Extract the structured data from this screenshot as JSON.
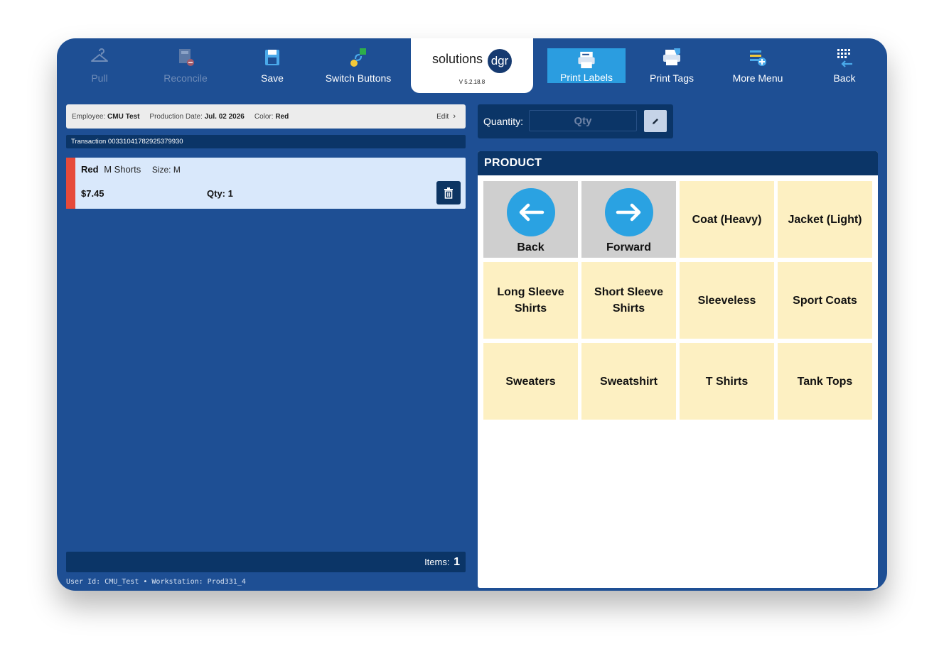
{
  "toolbar": {
    "pull": {
      "label": "Pull",
      "icon": "hanger-icon"
    },
    "reconcile": {
      "label": "Reconcile",
      "icon": "reconcile-icon"
    },
    "save": {
      "label": "Save",
      "icon": "save-icon"
    },
    "switch": {
      "label": "Switch Buttons",
      "icon": "switch-icon"
    },
    "print_labels": {
      "label": "Print Labels",
      "icon": "print-labels-icon"
    },
    "print_tags": {
      "label": "Print Tags",
      "icon": "print-tags-icon"
    },
    "more_menu": {
      "label": "More Menu",
      "icon": "more-menu-icon"
    },
    "back": {
      "label": "Back",
      "icon": "keypad-back-icon"
    }
  },
  "logo": {
    "text": "solutions",
    "mark": "dgr",
    "version": "V 5.2.18.8"
  },
  "info": {
    "employee_label": "Employee:",
    "employee": "CMU Test",
    "date_label": "Production Date:",
    "date": "Jul. 02 2026",
    "color_label": "Color:",
    "color": "Red",
    "edit": "Edit"
  },
  "transaction": "Transaction 00331041782925379930",
  "item": {
    "color": "Red",
    "name": "M Shorts",
    "size": "Size: M",
    "price": "$7.45",
    "qty": "Qty: 1"
  },
  "items_bar": {
    "label": "Items:",
    "count": "1"
  },
  "footer": "User Id: CMU_Test • Workstation: Prod331_4",
  "quantity": {
    "label": "Quantity:",
    "placeholder": "Qty"
  },
  "product": {
    "header": "PRODUCT",
    "back": "Back",
    "forward": "Forward",
    "tiles": [
      "Coat (Heavy)",
      "Jacket (Light)",
      "Long Sleeve Shirts",
      "Short Sleeve Shirts",
      "Sleeveless",
      "Sport Coats",
      "Sweaters",
      "Sweatshirt",
      "T Shirts",
      "Tank Tops"
    ]
  },
  "colors": {
    "background": "#1e4f94",
    "dark_bar": "#0b3567",
    "accent": "#2b9de0",
    "tile": "#fdf0c2",
    "nav_tile": "#cfcfcf",
    "item_stripe": "#e64a3a"
  }
}
